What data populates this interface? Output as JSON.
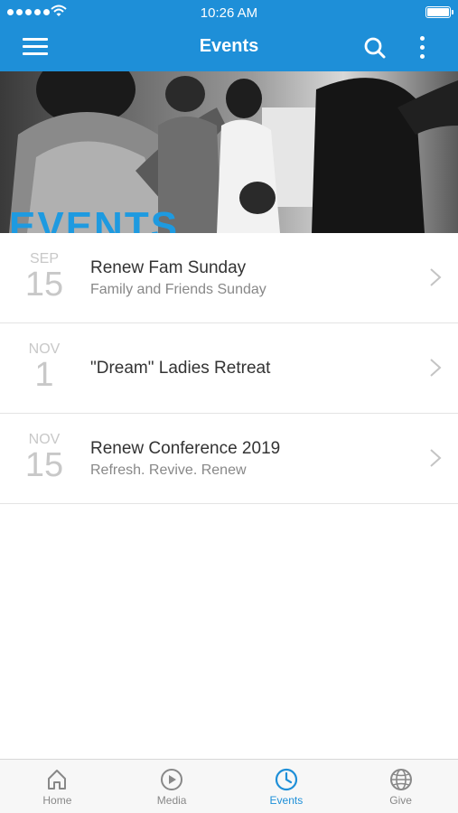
{
  "status_bar": {
    "time": "10:26 AM"
  },
  "nav": {
    "title": "Events"
  },
  "hero": {
    "text": "EVENTS"
  },
  "events": [
    {
      "month": "SEP",
      "day": "15",
      "title": "Renew Fam Sunday",
      "subtitle": "Family and Friends Sunday"
    },
    {
      "month": "NOV",
      "day": "1",
      "title": "\"Dream\" Ladies Retreat",
      "subtitle": ""
    },
    {
      "month": "NOV",
      "day": "15",
      "title": "Renew Conference 2019",
      "subtitle": "Refresh. Revive. Renew"
    }
  ],
  "tabs": [
    {
      "label": "Home",
      "icon": "home-icon"
    },
    {
      "label": "Media",
      "icon": "play-circle-icon"
    },
    {
      "label": "Events",
      "icon": "clock-icon",
      "active": true
    },
    {
      "label": "Give",
      "icon": "globe-icon"
    }
  ],
  "colors": {
    "accent": "#1e8fd8",
    "date_gray": "#c8c8c8",
    "tab_gray": "#888888"
  }
}
